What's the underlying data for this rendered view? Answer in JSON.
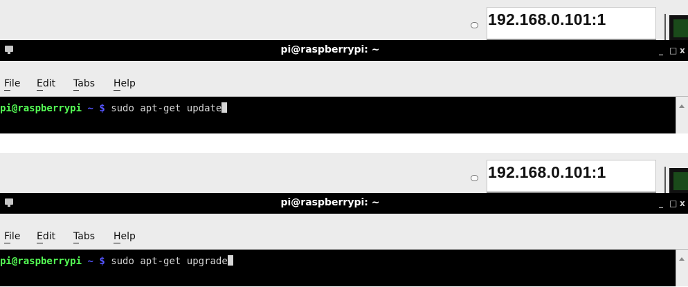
{
  "panels": [
    {
      "address": "192.168.0.101:1",
      "window_title": "pi@raspberrypi: ~",
      "controls": {
        "minimize": "_",
        "maximize": "□",
        "close": "x"
      },
      "menu": [
        "File",
        "Edit",
        "Tabs",
        "Help"
      ],
      "prompt": {
        "user_host": "pi@raspberrypi",
        "dir": "~",
        "symbol": "$",
        "command": "sudo apt-get update"
      }
    },
    {
      "address": "192.168.0.101:1",
      "window_title": "pi@raspberrypi: ~",
      "controls": {
        "minimize": "_",
        "maximize": "□",
        "close": "x"
      },
      "menu": [
        "File",
        "Edit",
        "Tabs",
        "Help"
      ],
      "prompt": {
        "user_host": "pi@raspberrypi",
        "dir": "~",
        "symbol": "$",
        "command": "sudo apt-get upgrade"
      }
    }
  ],
  "colors": {
    "prompt_user": "#55ff55",
    "prompt_dir": "#5555ff",
    "terminal_bg": "#000000",
    "vnc_button": "#1a4a1a"
  },
  "icons": [
    "status-circle-icon",
    "terminal-app-icon",
    "scroll-up-arrow-icon"
  ]
}
